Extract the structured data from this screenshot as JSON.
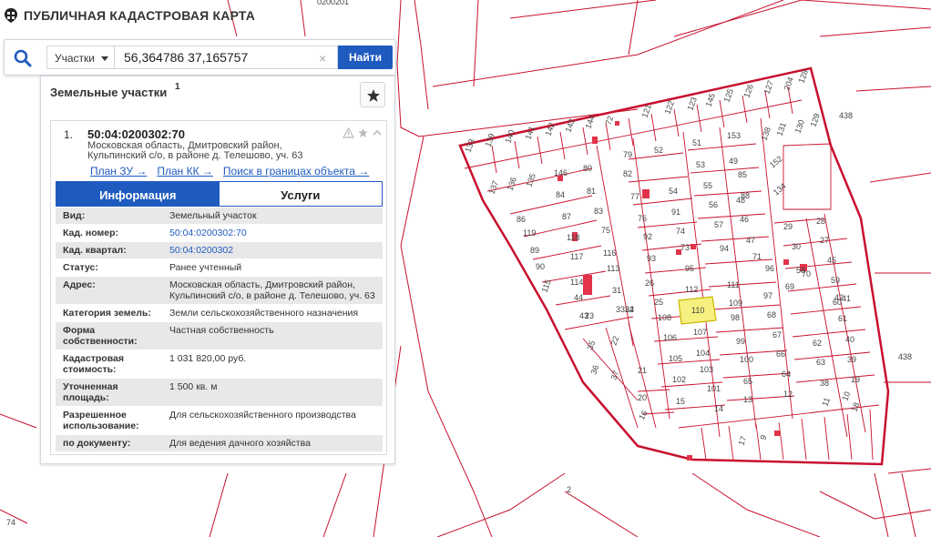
{
  "app": {
    "title": "ПУБЛИЧНАЯ КАДАСТРОВАЯ КАРТА"
  },
  "search": {
    "type_label": "Участки",
    "query": "56,364786 37,165757",
    "clear_glyph": "×",
    "button_label": "Найти"
  },
  "panel": {
    "title": "Земельные участки",
    "count": "1",
    "card": {
      "index": "1.",
      "cad_number": "50:04:0200302:70",
      "address_short": "Московская область, Дмитровский район, Кульпинский с/о, в районе д. Телешово, уч. 63",
      "links": [
        "План ЗУ →",
        "План КК →",
        "Поиск в границах объекта →"
      ],
      "tabs": [
        "Информация",
        "Услуги"
      ],
      "properties": [
        {
          "label": "Вид:",
          "value": "Земельный участок"
        },
        {
          "label": "Кад. номер:",
          "value": "50:04:0200302:70"
        },
        {
          "label": "Кад. квартал:",
          "value": "50:04:0200302"
        },
        {
          "label": "Статус:",
          "value": "Ранее учтенный"
        },
        {
          "label": "Адрес:",
          "value": "Московская область, Дмитровский район, Кульпинский с/о, в районе д. Телешово, уч. 63"
        },
        {
          "label": "Категория земель:",
          "value": "Земли сельскохозяйственного назначения"
        },
        {
          "label": "Форма собственности:",
          "value": "Частная собственность"
        },
        {
          "label": "Кадастровая стоимость:",
          "value": "1 031 820,00 руб."
        },
        {
          "label": "Уточненная площадь:",
          "value": "1 500 кв. м"
        },
        {
          "label": "Разрешенное использование:",
          "value": "Для сельскохозяйственного производства"
        },
        {
          "label": "по документу:",
          "value": "Для ведения дачного хозяйства"
        }
      ]
    }
  },
  "map": {
    "colors": {
      "boundary": "#c8102e",
      "selected_fill": "#f5f080",
      "selected_stroke": "#c9b800"
    },
    "top_edge_label": "0200201",
    "labels": [
      "438",
      "438",
      "2",
      "74"
    ],
    "selected_plot": "70",
    "plots": [
      "133",
      "139",
      "140",
      "141",
      "142",
      "143",
      "144",
      "72",
      "121",
      "122",
      "123",
      "145",
      "125",
      "126",
      "127",
      "204",
      "128",
      "129",
      "130",
      "131",
      "138",
      "137",
      "136",
      "135",
      "146",
      "80",
      "79",
      "52",
      "51",
      "153",
      "152",
      "134",
      "84",
      "81",
      "82",
      "77",
      "54",
      "53",
      "49",
      "85",
      "86",
      "87",
      "83",
      "76",
      "91",
      "55",
      "48",
      "88",
      "119",
      "118",
      "75",
      "74",
      "56",
      "46",
      "29",
      "28",
      "89",
      "117",
      "116",
      "92",
      "93",
      "73",
      "57",
      "47",
      "30",
      "27",
      "90",
      "115",
      "114",
      "113",
      "95",
      "94",
      "71",
      "58",
      "45",
      "44",
      "31",
      "26",
      "112",
      "111",
      "96",
      "70",
      "59",
      "43",
      "3332",
      "25",
      "110",
      "109",
      "97",
      "69",
      "60",
      "42",
      "23",
      "24",
      "108",
      "107",
      "98",
      "68",
      "61",
      "41",
      "35",
      "22",
      "106",
      "104",
      "99",
      "67",
      "62",
      "40",
      "36",
      "21",
      "105",
      "103",
      "100",
      "66",
      "63",
      "39",
      "37",
      "20",
      "102",
      "101",
      "65",
      "64",
      "38",
      "19",
      "16",
      "15",
      "14",
      "13",
      "12",
      "11",
      "10",
      "18",
      "17",
      "9"
    ]
  }
}
